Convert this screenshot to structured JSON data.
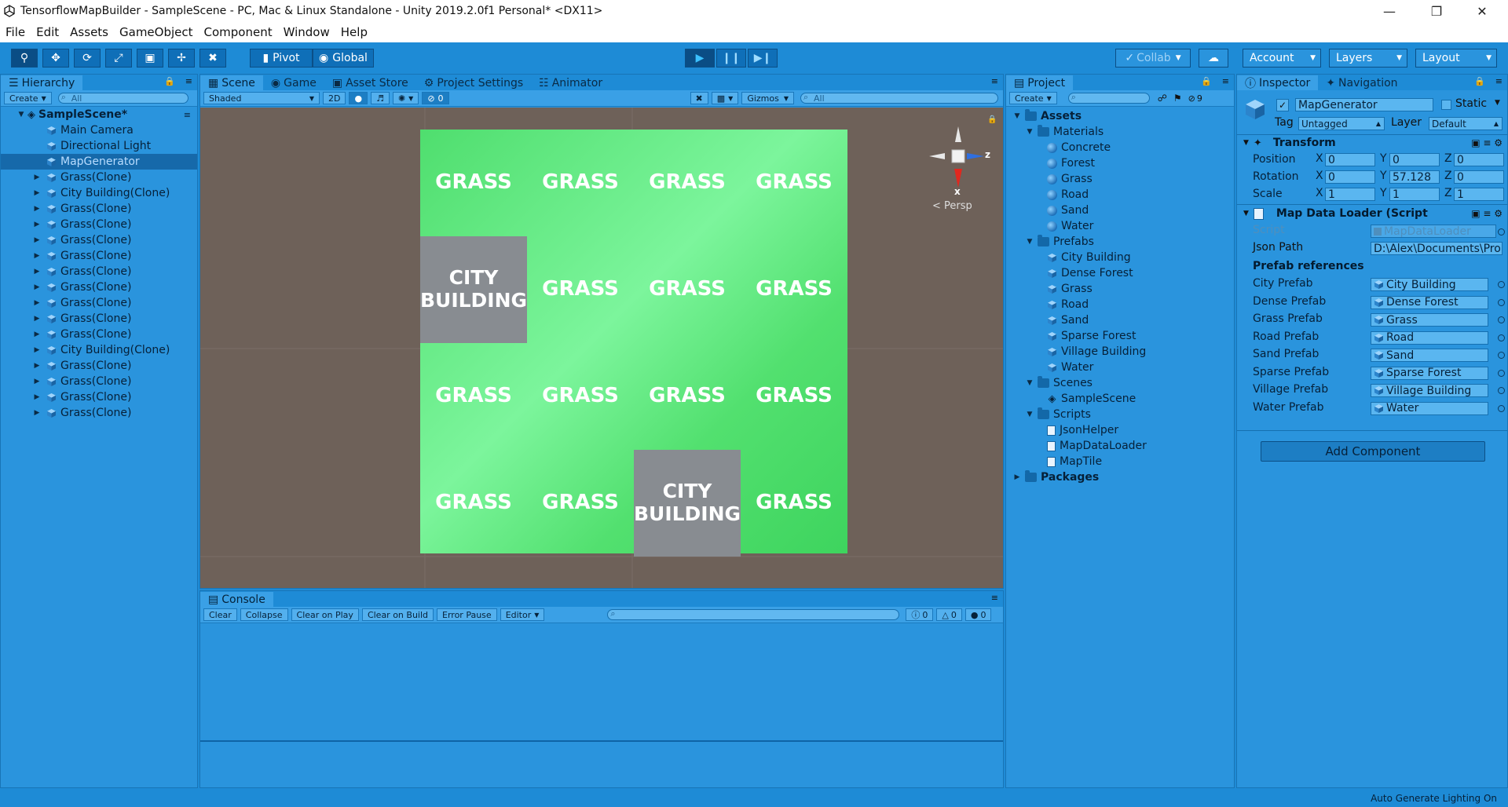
{
  "window": {
    "title": "TensorflowMapBuilder - SampleScene - PC, Mac & Linux Standalone - Unity 2019.2.0f1 Personal* <DX11>"
  },
  "menu": [
    "File",
    "Edit",
    "Assets",
    "GameObject",
    "Component",
    "Window",
    "Help"
  ],
  "toolbar": {
    "pivot_label": "Pivot",
    "global_label": "Global",
    "collab_label": "Collab",
    "account_label": "Account",
    "layers_label": "Layers",
    "layout_label": "Layout"
  },
  "hierarchy": {
    "tab_label": "Hierarchy",
    "create_label": "Create",
    "search_placeholder": "All",
    "scene_name": "SampleScene*",
    "items": [
      {
        "label": "Main Camera",
        "expandable": false,
        "selected": false
      },
      {
        "label": "Directional Light",
        "expandable": false,
        "selected": false
      },
      {
        "label": "MapGenerator",
        "expandable": false,
        "selected": true
      },
      {
        "label": "Grass(Clone)",
        "expandable": true,
        "selected": false
      },
      {
        "label": "City Building(Clone)",
        "expandable": true,
        "selected": false
      },
      {
        "label": "Grass(Clone)",
        "expandable": true,
        "selected": false
      },
      {
        "label": "Grass(Clone)",
        "expandable": true,
        "selected": false
      },
      {
        "label": "Grass(Clone)",
        "expandable": true,
        "selected": false
      },
      {
        "label": "Grass(Clone)",
        "expandable": true,
        "selected": false
      },
      {
        "label": "Grass(Clone)",
        "expandable": true,
        "selected": false
      },
      {
        "label": "Grass(Clone)",
        "expandable": true,
        "selected": false
      },
      {
        "label": "Grass(Clone)",
        "expandable": true,
        "selected": false
      },
      {
        "label": "Grass(Clone)",
        "expandable": true,
        "selected": false
      },
      {
        "label": "Grass(Clone)",
        "expandable": true,
        "selected": false
      },
      {
        "label": "City Building(Clone)",
        "expandable": true,
        "selected": false
      },
      {
        "label": "Grass(Clone)",
        "expandable": true,
        "selected": false
      },
      {
        "label": "Grass(Clone)",
        "expandable": true,
        "selected": false
      },
      {
        "label": "Grass(Clone)",
        "expandable": true,
        "selected": false
      },
      {
        "label": "Grass(Clone)",
        "expandable": true,
        "selected": false
      }
    ]
  },
  "scene": {
    "tabs": [
      "Scene",
      "Game",
      "Asset Store",
      "Project Settings",
      "Animator"
    ],
    "shading_mode": "Shaded",
    "mode_2d_label": "2D",
    "hidden_count": "0",
    "gizmos_label": "Gizmos",
    "search_placeholder": "All",
    "persp_label": "< Persp",
    "gizmo_z": "z",
    "gizmo_x": "x",
    "tiles": [
      [
        "GRASS",
        "GRASS",
        "GRASS",
        "GRASS"
      ],
      [
        "CITY BUILDING",
        "GRASS",
        "GRASS",
        "GRASS"
      ],
      [
        "GRASS",
        "GRASS",
        "GRASS",
        "GRASS"
      ],
      [
        "GRASS",
        "GRASS",
        "CITY BUILDING",
        "GRASS"
      ]
    ]
  },
  "console": {
    "tab_label": "Console",
    "buttons": [
      "Clear",
      "Collapse",
      "Clear on Play",
      "Clear on Build",
      "Error Pause",
      "Editor"
    ],
    "info_count": "0",
    "warning_count": "0",
    "error_count": "0"
  },
  "project": {
    "tab_label": "Project",
    "create_label": "Create",
    "filter_count": "9",
    "tree": [
      {
        "label": "Assets",
        "depth": 0,
        "kind": "folder",
        "bold": true,
        "open": true
      },
      {
        "label": "Materials",
        "depth": 1,
        "kind": "folder",
        "open": true
      },
      {
        "label": "Concrete",
        "depth": 2,
        "kind": "material"
      },
      {
        "label": "Forest",
        "depth": 2,
        "kind": "material"
      },
      {
        "label": "Grass",
        "depth": 2,
        "kind": "material"
      },
      {
        "label": "Road",
        "depth": 2,
        "kind": "material"
      },
      {
        "label": "Sand",
        "depth": 2,
        "kind": "material"
      },
      {
        "label": "Water",
        "depth": 2,
        "kind": "material"
      },
      {
        "label": "Prefabs",
        "depth": 1,
        "kind": "folder",
        "open": true
      },
      {
        "label": "City Building",
        "depth": 2,
        "kind": "prefab"
      },
      {
        "label": "Dense Forest",
        "depth": 2,
        "kind": "prefab"
      },
      {
        "label": "Grass",
        "depth": 2,
        "kind": "prefab"
      },
      {
        "label": "Road",
        "depth": 2,
        "kind": "prefab"
      },
      {
        "label": "Sand",
        "depth": 2,
        "kind": "prefab"
      },
      {
        "label": "Sparse Forest",
        "depth": 2,
        "kind": "prefab"
      },
      {
        "label": "Village Building",
        "depth": 2,
        "kind": "prefab"
      },
      {
        "label": "Water",
        "depth": 2,
        "kind": "prefab"
      },
      {
        "label": "Scenes",
        "depth": 1,
        "kind": "folder",
        "open": true
      },
      {
        "label": "SampleScene",
        "depth": 2,
        "kind": "scene"
      },
      {
        "label": "Scripts",
        "depth": 1,
        "kind": "folder",
        "open": true
      },
      {
        "label": "JsonHelper",
        "depth": 2,
        "kind": "script"
      },
      {
        "label": "MapDataLoader",
        "depth": 2,
        "kind": "script"
      },
      {
        "label": "MapTile",
        "depth": 2,
        "kind": "script"
      },
      {
        "label": "Packages",
        "depth": 0,
        "kind": "folder",
        "bold": true,
        "open": false
      }
    ]
  },
  "inspector": {
    "tabs": [
      "Inspector",
      "Navigation"
    ],
    "object_name": "MapGenerator",
    "static_label": "Static",
    "tag_label": "Tag",
    "tag_value": "Untagged",
    "layer_label": "Layer",
    "layer_value": "Default",
    "transform": {
      "title": "Transform",
      "position_label": "Position",
      "rotation_label": "Rotation",
      "scale_label": "Scale",
      "position": [
        "0",
        "0",
        "0"
      ],
      "rotation": [
        "0",
        "57.128",
        "0"
      ],
      "scale": [
        "1",
        "1",
        "1"
      ]
    },
    "map_loader": {
      "title": "Map Data Loader (Script",
      "script_label": "Script",
      "script_value": "MapDataLoader",
      "json_label": "Json Path",
      "json_value": "D:\\Alex\\Documents\\Pro",
      "section_label": "Prefab references",
      "prefabs": [
        {
          "label": "City Prefab",
          "value": "City Building"
        },
        {
          "label": "Dense Prefab",
          "value": "Dense Forest"
        },
        {
          "label": "Grass Prefab",
          "value": "Grass"
        },
        {
          "label": "Road Prefab",
          "value": "Road"
        },
        {
          "label": "Sand Prefab",
          "value": "Sand"
        },
        {
          "label": "Sparse Prefab",
          "value": "Sparse Forest"
        },
        {
          "label": "Village Prefab",
          "value": "Village Building"
        },
        {
          "label": "Water Prefab",
          "value": "Water"
        }
      ]
    },
    "add_component_label": "Add Component"
  },
  "status": {
    "text": "Auto Generate Lighting On"
  },
  "colors": {
    "accent": "#1e8bd6",
    "panel": "#2a94dd",
    "grass_light": "#7cf59c",
    "grass_dark": "#3ed45e",
    "city": "#888c91",
    "scene_bg": "#6e6159"
  }
}
